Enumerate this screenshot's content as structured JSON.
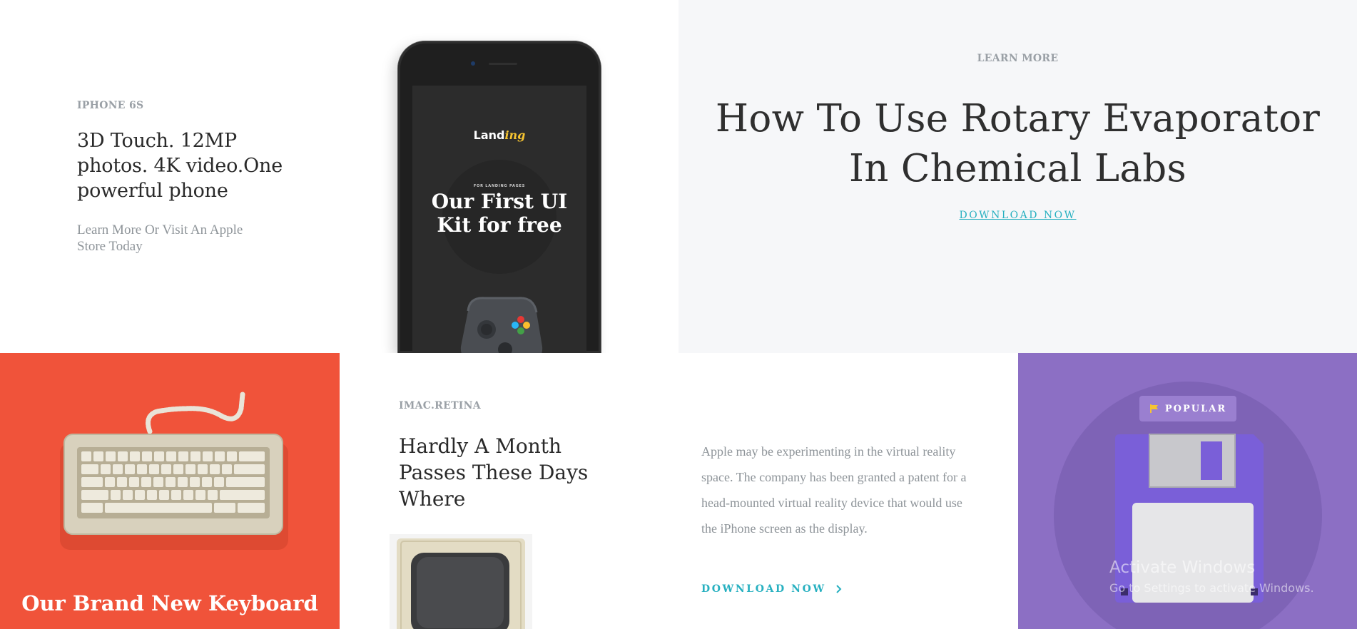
{
  "iphone_tile": {
    "eyebrow": "IPHONE 6S",
    "title": "3D Touch. 12MP photos. 4K video.One powerful phone",
    "subtitle": "Learn More Or Visit An Apple Store Today",
    "phone_screen": {
      "logo_main": "Land",
      "logo_accent": "ing",
      "kicker": "FOR LANDING PAGES",
      "headline": "Our First UI Kit for free"
    }
  },
  "learn_tile": {
    "eyebrow": "LEARN MORE",
    "title": "How To Use Rotary Evaporator In Chemical Labs",
    "link": "DOWNLOAD NOW"
  },
  "keyboard_tile": {
    "title": "Our Brand New Keyboard",
    "background": "#f0533a"
  },
  "imac_tile": {
    "eyebrow": "IMAC.RETINA",
    "title": "Hardly A Month Passes These Days Where"
  },
  "text_tile": {
    "body": "Apple may be experimenting in the virtual reality space. The company has been granted a patent for a head-mounted virtual reality device that would use the iPhone screen as the display.",
    "link": "DOWNLOAD NOW",
    "link_icon": "chevron-right-icon",
    "accent": "#27b0c0"
  },
  "floppy_tile": {
    "badge": "POPULAR",
    "badge_icon": "flag-icon",
    "background": "#8c6fc4"
  },
  "os_watermark": {
    "title": "Activate Windows",
    "subtitle": "Go to Settings to activate Windows."
  }
}
